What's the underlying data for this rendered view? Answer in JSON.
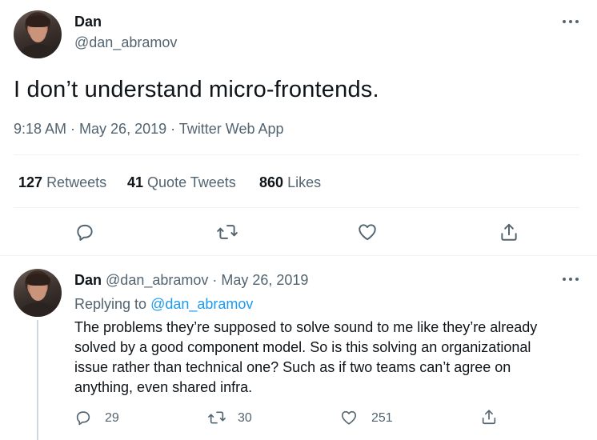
{
  "main_tweet": {
    "display_name": "Dan",
    "handle": "@dan_abramov",
    "text": "I don’t understand micro-frontends.",
    "meta": "9:18 AM · May 26, 2019 · Twitter Web App",
    "stats": [
      {
        "value": "127",
        "label": "Retweets"
      },
      {
        "value": "41",
        "label": "Quote Tweets"
      },
      {
        "value": "860",
        "label": "Likes"
      }
    ],
    "icons": [
      "reply-icon",
      "retweet-icon",
      "like-icon",
      "share-icon"
    ]
  },
  "reply_tweet": {
    "display_name": "Dan",
    "handle_date": "@dan_abramov · May 26, 2019",
    "replying_prefix": "Replying to",
    "replying_to": "@dan_abramov",
    "text_lines": [
      "The problems they’re supposed to solve sound to me like they’re already",
      "solved by a good component model. So is this solving an organizational",
      "issue rather than technical one? Such as if two teams can’t agree on",
      "anything, even shared infra."
    ],
    "counts": {
      "replies": "29",
      "retweets": "30",
      "likes": "251"
    }
  },
  "colors": {
    "text": "#0f1419",
    "muted": "#536471",
    "link": "#1d9bf0",
    "divider": "#eff3f4"
  }
}
